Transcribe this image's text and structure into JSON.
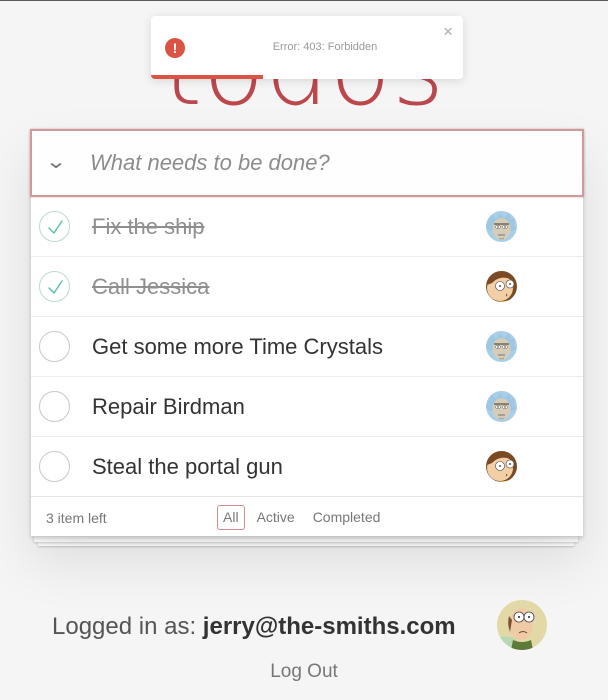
{
  "app": {
    "title": "todos"
  },
  "toast": {
    "icon": "error-icon",
    "message": "Error: 403: Forbidden",
    "close_label": "×",
    "progress": 0.36,
    "color": "#db5342"
  },
  "new_todo": {
    "placeholder": "What needs to be done?",
    "value": "",
    "toggle_all_icon": "chevron-down-icon"
  },
  "todos": [
    {
      "label": "Fix the ship",
      "completed": true,
      "assignee": "rick"
    },
    {
      "label": "Call Jessica",
      "completed": true,
      "assignee": "morty"
    },
    {
      "label": "Get some more Time Crystals",
      "completed": false,
      "assignee": "rick"
    },
    {
      "label": "Repair Birdman",
      "completed": false,
      "assignee": "rick"
    },
    {
      "label": "Steal the portal gun",
      "completed": false,
      "assignee": "morty"
    }
  ],
  "footer": {
    "items_left": "3 item left",
    "filters": [
      {
        "label": "All",
        "selected": true
      },
      {
        "label": "Active",
        "selected": false
      },
      {
        "label": "Completed",
        "selected": false
      }
    ]
  },
  "user": {
    "prefix": "Logged in as: ",
    "email": "jerry@the-smiths.com",
    "avatar": "jerry",
    "logout_label": "Log Out"
  },
  "colors": {
    "accent": "#b83f45",
    "check": "#5dc2af",
    "check_border": "#bddad5"
  }
}
